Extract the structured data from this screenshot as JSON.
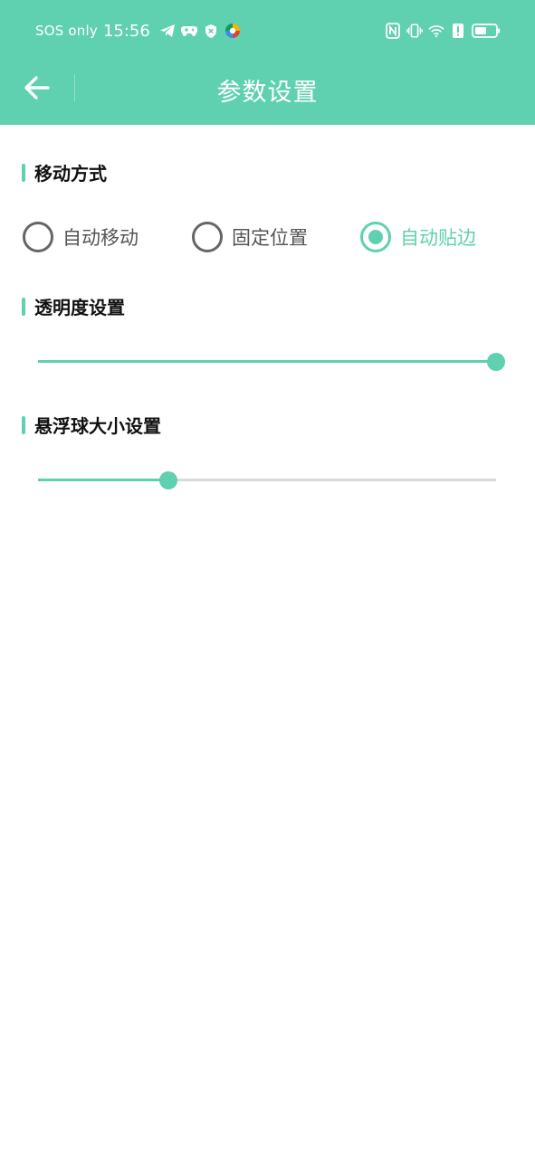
{
  "status_bar": {
    "carrier": "SOS only",
    "time": "15:56",
    "left_icons": [
      "telegram-icon",
      "game-controller-icon",
      "shield-icon",
      "colorful-app-icon"
    ],
    "right_icons": [
      "nfc-icon",
      "vibrate-icon",
      "wifi-icon",
      "alert-icon",
      "battery-icon"
    ]
  },
  "app_bar": {
    "title": "参数设置",
    "back_icon": "back-arrow-icon"
  },
  "sections": {
    "move_mode": {
      "title": "移动方式",
      "options": [
        {
          "label": "自动移动",
          "checked": false
        },
        {
          "label": "固定位置",
          "checked": false
        },
        {
          "label": "自动贴边",
          "checked": true
        }
      ]
    },
    "opacity": {
      "title": "透明度设置",
      "value_fraction": 1.0
    },
    "ball_size": {
      "title": "悬浮球大小设置",
      "value_fraction": 0.285
    }
  },
  "colors": {
    "accent": "#5fd0b0",
    "text_dark": "#111111",
    "text_gray": "#555555",
    "track_gray": "#d9d9d9"
  }
}
